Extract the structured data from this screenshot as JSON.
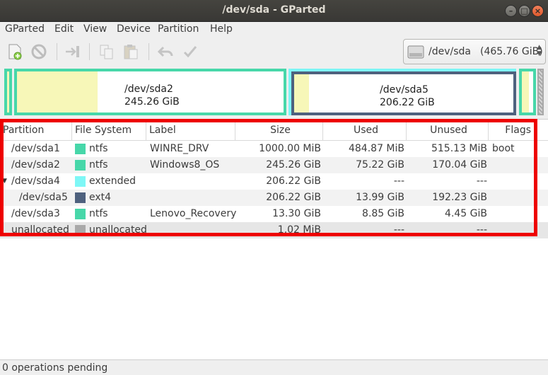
{
  "window": {
    "title": "/dev/sda - GParted"
  },
  "menu": [
    "GParted",
    "Edit",
    "View",
    "Device",
    "Partition",
    "Help"
  ],
  "toolbar": {
    "buttons": [
      "new-icon",
      "delete-icon",
      "resize-move-icon",
      "copy-icon",
      "paste-icon",
      "undo-icon",
      "apply-icon"
    ]
  },
  "device_selector": {
    "device": "/dev/sda",
    "size": "(465.76 GiB)"
  },
  "graph": {
    "sda2": {
      "name": "/dev/sda2",
      "size": "245.26 GiB"
    },
    "sda5": {
      "name": "/dev/sda5",
      "size": "206.22 GiB"
    }
  },
  "table": {
    "headers": [
      "Partition",
      "File System",
      "Label",
      "Size",
      "Used",
      "Unused",
      "Flags"
    ],
    "rows": [
      {
        "partition": "/dev/sda1",
        "fs": "ntfs",
        "fs_color": "#47d7a9",
        "label": "WINRE_DRV",
        "size": "1000.00 MiB",
        "used": "484.87 MiB",
        "unused": "515.13 MiB",
        "flags": "boot"
      },
      {
        "partition": "/dev/sda2",
        "fs": "ntfs",
        "fs_color": "#47d7a9",
        "label": "Windows8_OS",
        "size": "245.26 GiB",
        "used": "75.22 GiB",
        "unused": "170.04 GiB",
        "flags": ""
      },
      {
        "partition": "/dev/sda4",
        "fs": "extended",
        "fs_color": "#7ef7f6",
        "label": "",
        "size": "206.22 GiB",
        "used": "---",
        "unused": "---",
        "flags": ""
      },
      {
        "partition": "/dev/sda5",
        "fs": "ext4",
        "fs_color": "#4e617e",
        "label": "",
        "size": "206.22 GiB",
        "used": "13.99 GiB",
        "unused": "192.23 GiB",
        "flags": ""
      },
      {
        "partition": "/dev/sda3",
        "fs": "ntfs",
        "fs_color": "#47d7a9",
        "label": "Lenovo_Recovery",
        "size": "13.30 GiB",
        "used": "8.85 GiB",
        "unused": "4.45 GiB",
        "flags": ""
      },
      {
        "partition": "unallocated",
        "fs": "unallocated",
        "fs_color": "#a9a9a9",
        "label": "",
        "size": "1.02 MiB",
        "used": "---",
        "unused": "---",
        "flags": ""
      }
    ]
  },
  "status": {
    "text": "0 operations pending"
  },
  "colors": {
    "ntfs": "#47d7a9",
    "extended": "#7ef7f6",
    "ext4": "#4e617e",
    "unallocated": "#a9a9a9",
    "highlight": "#ee0000"
  }
}
